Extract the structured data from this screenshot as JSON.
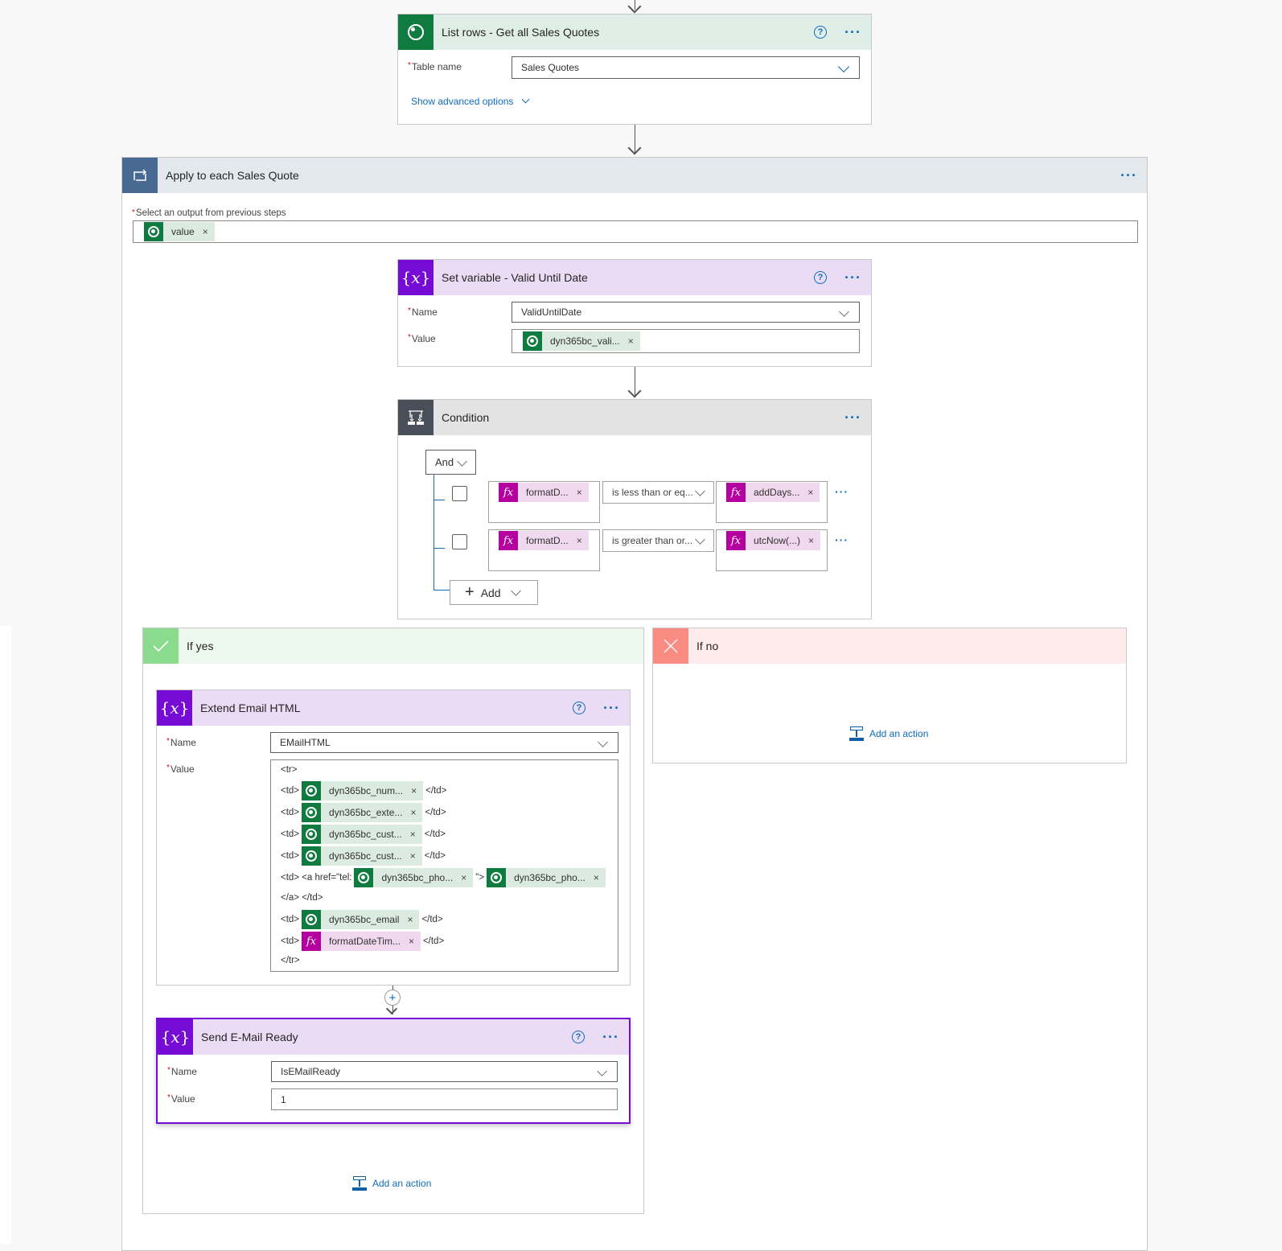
{
  "list_rows": {
    "title": "List rows - Get all Sales Quotes",
    "icon": "dataverse-icon",
    "table_name_label": "Table name",
    "table_name_value": "Sales Quotes",
    "advanced_link": "Show advanced options"
  },
  "apply_each": {
    "title": "Apply to each Sales Quote",
    "icon": "loop-icon",
    "output_label": "Select an output from previous steps",
    "output_token": "value"
  },
  "set_variable": {
    "title": "Set variable - Valid Until Date",
    "icon": "variable-icon",
    "name_label": "Name",
    "name_value": "ValidUntilDate",
    "value_label": "Value",
    "value_token": "dyn365bc_vali..."
  },
  "condition": {
    "title": "Condition",
    "icon": "condition-icon",
    "group_operator": "And",
    "rows": [
      {
        "left": "formatD...",
        "operator": "is less than or eq...",
        "right": "addDays..."
      },
      {
        "left": "formatD...",
        "operator": "is greater than or...",
        "right": "utcNow(...)"
      }
    ],
    "add_label": "Add"
  },
  "if_yes": {
    "title": "If yes",
    "extend_email": {
      "title": "Extend Email HTML",
      "name_label": "Name",
      "name_value": "EMailHTML",
      "value_label": "Value",
      "lines": {
        "tr_open": "<tr>",
        "td": "<td>",
        "td_close": "</td>",
        "a_open": "<td> <a href=\"tel:",
        "a_mid": "\">",
        "a_close": "</a> </td>",
        "tr_close": "</tr>",
        "tokens": [
          "dyn365bc_num...",
          "dyn365bc_exte...",
          "dyn365bc_cust...",
          "dyn365bc_cust...",
          "dyn365bc_pho...",
          "dyn365bc_pho...",
          "dyn365bc_email",
          "formatDateTim..."
        ]
      }
    },
    "send_email": {
      "title": "Send E-Mail Ready",
      "name_label": "Name",
      "name_value": "IsEMailReady",
      "value_label": "Value",
      "value_value": "1"
    },
    "add_action": "Add an action"
  },
  "if_no": {
    "title": "If no",
    "add_action": "Add an action"
  },
  "common": {
    "help": "?",
    "more": "···",
    "remove": "×",
    "required": "*"
  },
  "colors": {
    "dataverse": "#0f7b3e",
    "variable": "#770bd6",
    "condition": "#484f58",
    "loop": "#486991",
    "expression": "#b4009e",
    "yes": "#8bdb8e",
    "no": "#f98b83",
    "accent": "#0f6cbd"
  }
}
